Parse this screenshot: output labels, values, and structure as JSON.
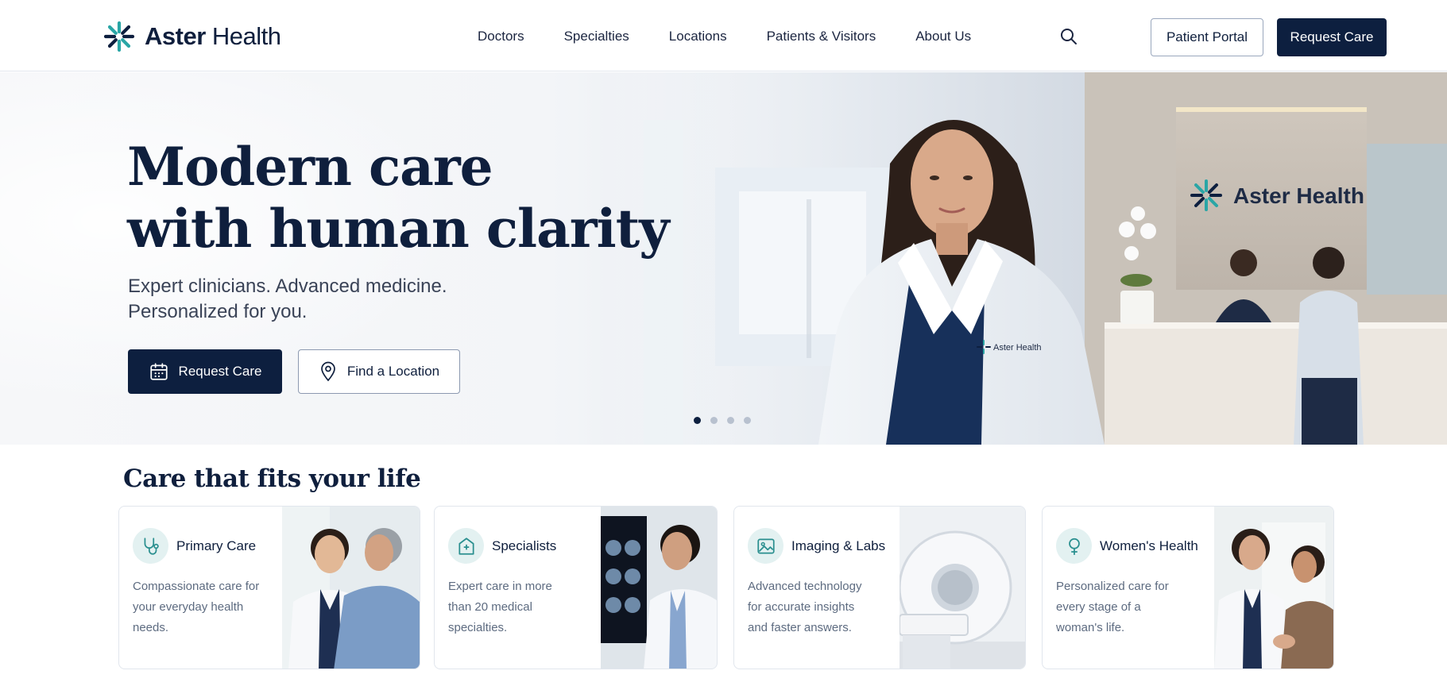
{
  "brand": {
    "name_bold": "Aster",
    "name_regular": " Health",
    "accent": "#2aa6a6",
    "navy": "#0d1f3f"
  },
  "nav": {
    "items": [
      "Doctors",
      "Specialties",
      "Locations",
      "Patients & Visitors",
      "About Us"
    ]
  },
  "header": {
    "patient_portal": "Patient Portal",
    "request_care": "Request Care",
    "search_icon": "search-icon"
  },
  "hero": {
    "title_line1": "Modern care",
    "title_line2": "with human clarity",
    "subtitle_line1": "Expert clinicians. Advanced medicine.",
    "subtitle_line2": "Personalized for you.",
    "primary_button": "Request Care",
    "secondary_button": "Find a Location",
    "wall_sign": "Aster Health",
    "coat_badge": "Aster Health",
    "carousel": {
      "count": 4,
      "active": 1
    }
  },
  "care": {
    "title": "Care that fits your life",
    "cards": [
      {
        "title": "Primary Care",
        "icon": "stethoscope-icon",
        "desc": [
          "Compassionate care for",
          "your everyday health",
          "needs."
        ]
      },
      {
        "title": "Specialists",
        "icon": "hospital-icon",
        "desc": [
          "Expert care in more",
          "than 20 medical",
          "specialties."
        ]
      },
      {
        "title": "Imaging & Labs",
        "icon": "image-icon",
        "desc": [
          "Advanced technology",
          "for accurate insights",
          "and faster answers."
        ]
      },
      {
        "title": "Women's Health",
        "icon": "female-symbol-icon",
        "desc": [
          "Personalized care for",
          "every stage of a",
          "woman's life."
        ]
      }
    ]
  }
}
